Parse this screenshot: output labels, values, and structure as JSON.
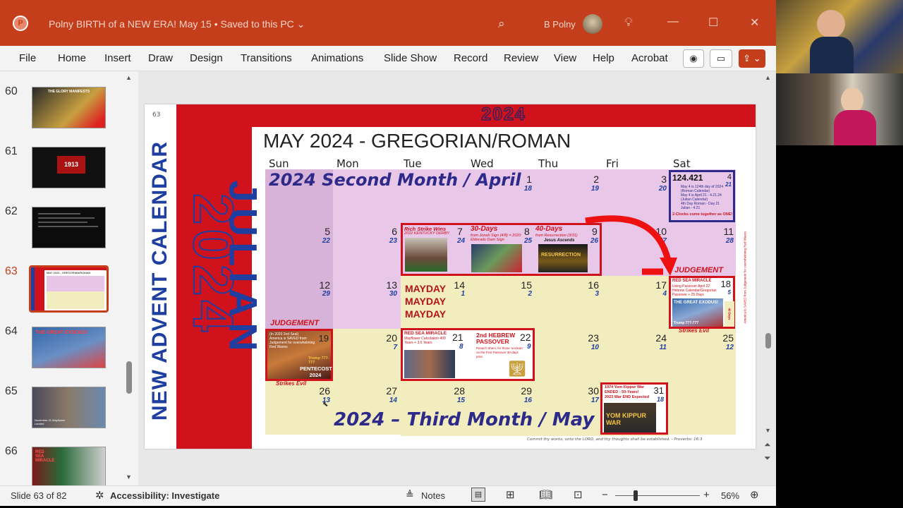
{
  "window": {
    "title": "Polny BIRTH of a NEW ERA! May 15 • Saved to this PC ⌄",
    "user": "B Polny",
    "controls": {
      "minimize": "—",
      "maximize": "☐",
      "close": "✕"
    }
  },
  "menu": [
    "File",
    "Home",
    "Insert",
    "Draw",
    "Design",
    "Transitions",
    "Animations",
    "Slide Show",
    "Record",
    "Review",
    "View",
    "Help",
    "Acrobat"
  ],
  "thumbnails": [
    {
      "num": "60",
      "label": "THE GLORY MANIFESTS"
    },
    {
      "num": "61",
      "label": "1913"
    },
    {
      "num": "62",
      "label": ""
    },
    {
      "num": "63",
      "label": "MAY 2024 - GREGORIAN/ROMAN"
    },
    {
      "num": "64",
      "label": "THE GREAT EXODUS!"
    },
    {
      "num": "65",
      "label": "November 21 Mayflower Landed"
    },
    {
      "num": "66",
      "label": "RED SEA MIRACLE"
    }
  ],
  "status": {
    "slide": "Slide 63 of 82",
    "accessibility": "Accessibility: Investigate",
    "notes": "Notes",
    "zoom": "56%"
  },
  "slide": {
    "number": "63",
    "year_banner": "2024",
    "side_vertical": "NEW ADVENT CALENDAR",
    "julian_vertical": "JULIAN",
    "title": "MAY 2024 - GREGORIAN/ROMAN",
    "days": [
      "Sun",
      "Mon",
      "Tue",
      "Wed",
      "Thu",
      "Fri",
      "Sat"
    ],
    "banner_top": "2024 Second Month / April",
    "banner_bottom": "2024 – Third Month / May",
    "footer": "Commit thy works, unto the LORD, and thy thoughts shall be established. - Proverbs: 16:3",
    "weeks": [
      [
        [
          "",
          ""
        ],
        [
          "",
          ""
        ],
        [
          "",
          ""
        ],
        [
          "1",
          "18"
        ],
        [
          "2",
          "19"
        ],
        [
          "3",
          "20"
        ],
        [
          "4",
          "21"
        ]
      ],
      [
        [
          "5",
          "22"
        ],
        [
          "6",
          "23"
        ],
        [
          "7",
          "24"
        ],
        [
          "8",
          "25"
        ],
        [
          "9",
          "26"
        ],
        [
          "10",
          "27"
        ],
        [
          "11",
          "28"
        ]
      ],
      [
        [
          "12",
          "29"
        ],
        [
          "13",
          "30"
        ],
        [
          "14",
          "1"
        ],
        [
          "15",
          "2"
        ],
        [
          "16",
          "3"
        ],
        [
          "17",
          "4"
        ],
        [
          "18",
          "5"
        ]
      ],
      [
        [
          "19",
          "6"
        ],
        [
          "20",
          "7"
        ],
        [
          "21",
          "8"
        ],
        [
          "22",
          "9"
        ],
        [
          "23",
          "10"
        ],
        [
          "24",
          "11"
        ],
        [
          "25",
          "12"
        ]
      ],
      [
        [
          "26",
          "13"
        ],
        [
          "27",
          "14"
        ],
        [
          "28",
          "15"
        ],
        [
          "29",
          "16"
        ],
        [
          "30",
          "17"
        ],
        [
          "31",
          "18"
        ],
        [
          "",
          ""
        ]
      ]
    ],
    "events": {
      "sat4": {
        "title": "124.421",
        "lines": [
          "May 4 is 124th day of 2024 (Roman Calendar)",
          "May 4 is April 21 - 4.21.24 (Julian Calendar)",
          "4th Day Roman - Day 21",
          "Julian - 4.21",
          "2-Clocks come together as ONE!"
        ]
      },
      "derby": {
        "title": "Rich Strike Wins",
        "sub": "2022 KENTUCKY DERBY"
      },
      "thirty": {
        "title": "30-Days",
        "sub": "from Jonah Sign (4/8) = 2020 Eldorado Dam Sign"
      },
      "forty": {
        "title": "40-Days",
        "sub": "from Resurrection (3/31)",
        "sub2": "Jesus Ascends",
        "img": "RESURRECTION"
      },
      "judgement": "JUDGEMENT",
      "mayday": [
        "MAYDAY",
        "MAYDAY",
        "MAYDAY"
      ],
      "redsea18": {
        "title": "RED SEA MIRACLE",
        "lines": [
          "Using Passover April 22",
          "Hebrew Calendar/Gregorian",
          "Passover + 25 Days"
        ],
        "img": "THE GREAT EXODUS!",
        "caption": "Trump 777-777",
        "days": "40 Days"
      },
      "redsea18_side": "America is SAVED from Judgement for overwhelming Red Waves",
      "strikes": "Strikes Evil",
      "pentecost": {
        "lines": [
          "(In 2020 2nd Seal)",
          "America is SAVED from Judgement for overwhelming Red Waves"
        ],
        "trump": "Trump 777-777",
        "label": "PENTECOST 2024"
      },
      "redsea21": {
        "title": "RED SEA MIRACLE",
        "sub": "Mayflower Calculation 400 Years + 3.5 Years"
      },
      "passover": {
        "title": "2nd HEBREW PASSOVER",
        "sub": "Pesach Sheni, for those 'unclean' on the First Passover 30-days prior."
      },
      "yomkippur": {
        "line1": "1974 Yom Kippur War",
        "line2": "ENDED - 50-Years!",
        "line3": "2023 War END Expected",
        "img": "YOM KIPPUR WAR"
      }
    }
  }
}
